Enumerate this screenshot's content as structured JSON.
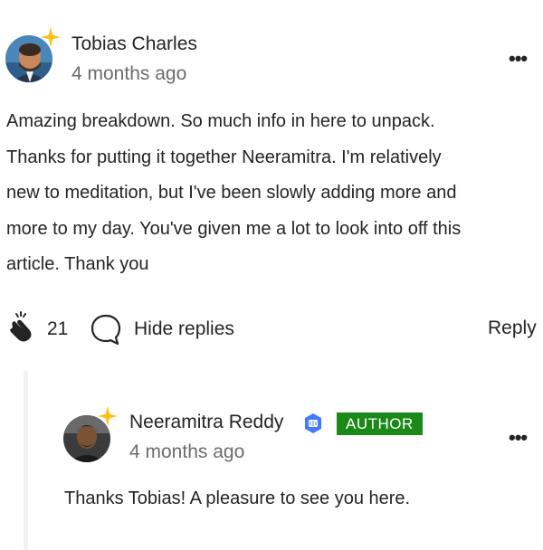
{
  "comment": {
    "author": "Tobias Charles",
    "time": "4 months ago",
    "text": "Amazing breakdown. So much info in here to unpack. Thanks for putting it together Neeramitra. I'm relatively new to meditation, but I've been slowly adding more and more to my day. You've given me a lot to look into off this article. Thank you",
    "lines": [
      "Amazing breakdown. So much info in here to unpack.",
      "Thanks for putting it together Neeramitra. I'm relatively",
      "new to meditation, but I've been slowly adding more and",
      "more to my day. You've given me a lot to look into off this",
      "article. Thank you"
    ],
    "claps": "21",
    "hide_replies_label": "Hide replies",
    "reply_label": "Reply",
    "more_label": "•••"
  },
  "reply": {
    "author": "Neeramitra Reddy",
    "badge": "AUTHOR",
    "time": "4 months ago",
    "text": "Thanks Tobias! A pleasure to see you here.",
    "more_label": "•••"
  },
  "colors": {
    "author_badge": "#1a8917",
    "star": "#ffc017",
    "verified": "#437aff"
  },
  "icons": {
    "clap": "clap-icon",
    "response": "speech-bubble-icon",
    "verified": "verified-badge-icon",
    "star": "star-icon"
  }
}
